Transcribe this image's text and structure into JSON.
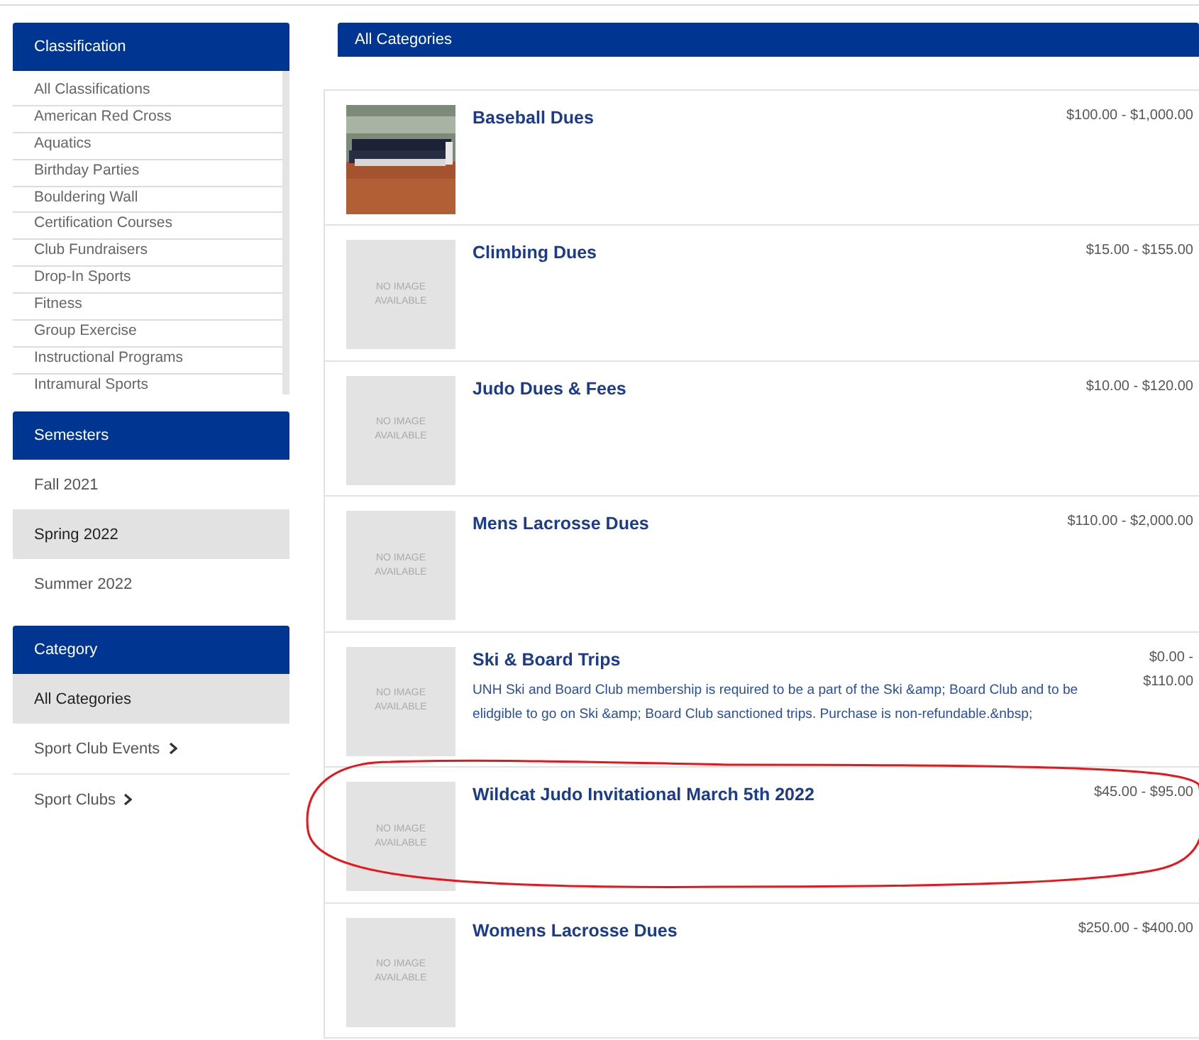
{
  "sidebar": {
    "classification": {
      "title": "Classification",
      "items": [
        "All Classifications",
        "American Red Cross",
        "Aquatics",
        "Birthday Parties",
        "Bouldering Wall",
        "Certification Courses",
        "Club Fundraisers",
        "Drop-In Sports",
        "Fitness",
        "Group Exercise",
        "Instructional Programs",
        "Intramural Sports"
      ]
    },
    "semesters": {
      "title": "Semesters",
      "items": [
        {
          "label": "Fall 2021",
          "selected": false
        },
        {
          "label": "Spring 2022",
          "selected": true
        },
        {
          "label": "Summer 2022",
          "selected": false
        }
      ]
    },
    "category": {
      "title": "Category",
      "items": [
        {
          "label": "All Categories",
          "selected": true,
          "expandable": false
        },
        {
          "label": "Sport Club Events",
          "selected": false,
          "expandable": true
        },
        {
          "label": "Sport Clubs",
          "selected": false,
          "expandable": true
        }
      ]
    }
  },
  "main": {
    "title": "All Categories",
    "products": [
      {
        "title": "Baseball Dues",
        "price": "$100.00 - $1,000.00",
        "circled": false
      },
      {
        "title": "Climbing Dues",
        "price": "$15.00 - $155.00",
        "image": {
          "kind": "placeholder",
          "text": "NO IMAGE AVAILABLE"
        },
        "circled": false
      },
      {
        "title": "Judo Dues & Fees",
        "price": "$10.00 - $120.00",
        "image": {
          "kind": "placeholder",
          "text": "NO IMAGE AVAILABLE"
        },
        "circled": false
      },
      {
        "title": "Mens Lacrosse Dues",
        "price": "$110.00 - $2,000.00",
        "image": {
          "kind": "placeholder",
          "text": "NO IMAGE AVAILABLE"
        },
        "circled": false
      },
      {
        "title": "Ski & Board Trips",
        "price": "$0.00 - $110.00",
        "description": "UNH Ski and Board Club membership is required to be a part of the Ski &amp; Board Club and to be elidgible to go on Ski &amp; Board Club sanctioned trips. Purchase is non-refundable.&nbsp;",
        "image": {
          "kind": "placeholder",
          "text": "NO IMAGE AVAILABLE"
        },
        "circled": false
      },
      {
        "title": "Wildcat Judo Invitational March 5th 2022",
        "price": "$45.00 - $95.00",
        "image": {
          "kind": "placeholder",
          "text": "NO IMAGE AVAILABLE"
        },
        "circled": true
      },
      {
        "title": "Womens Lacrosse Dues",
        "price": "$250.00 - $400.00",
        "image": {
          "kind": "placeholder",
          "text": "NO IMAGE AVAILABLE"
        },
        "circled": false
      }
    ]
  }
}
